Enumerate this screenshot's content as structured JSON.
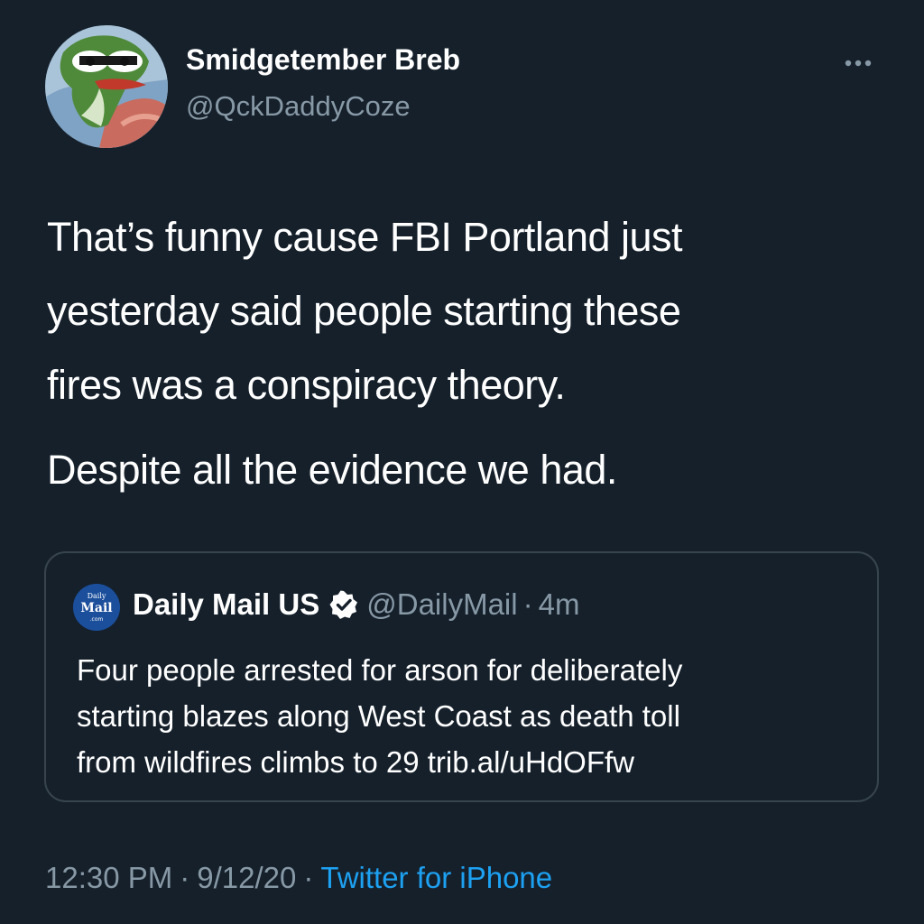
{
  "author": {
    "name": "Smidgetember Breb",
    "handle": "@QckDaddyCoze",
    "avatar_icon": "pepe-frog-avatar"
  },
  "menu": {
    "icon": "more-horizontal-icon"
  },
  "tweet": {
    "paragraph1_lines": [
      "That’s funny cause FBI Portland just",
      "yesterday said people starting these",
      "fires was a conspiracy theory."
    ],
    "paragraph2": "Despite all the evidence we had."
  },
  "quoted_tweet": {
    "logo_text": [
      "Daily",
      "Mail",
      ".com"
    ],
    "name": "Daily Mail US",
    "verified_icon": "verified-badge-icon",
    "handle": "@DailyMail",
    "separator": "·",
    "time": "4m",
    "text_lines": [
      "Four people arrested for arson for deliberately",
      "starting blazes along West Coast as death toll",
      "from wildfires climbs to 29 trib.al/uHdOFfw"
    ]
  },
  "footer": {
    "time": "12:30 PM",
    "separator": "·",
    "date": "9/12/20",
    "source": "Twitter for iPhone"
  },
  "colors": {
    "background": "#15202b",
    "text_primary": "#ffffff",
    "text_secondary": "#8899a6",
    "link": "#1da1f2",
    "border": "#38444d"
  }
}
